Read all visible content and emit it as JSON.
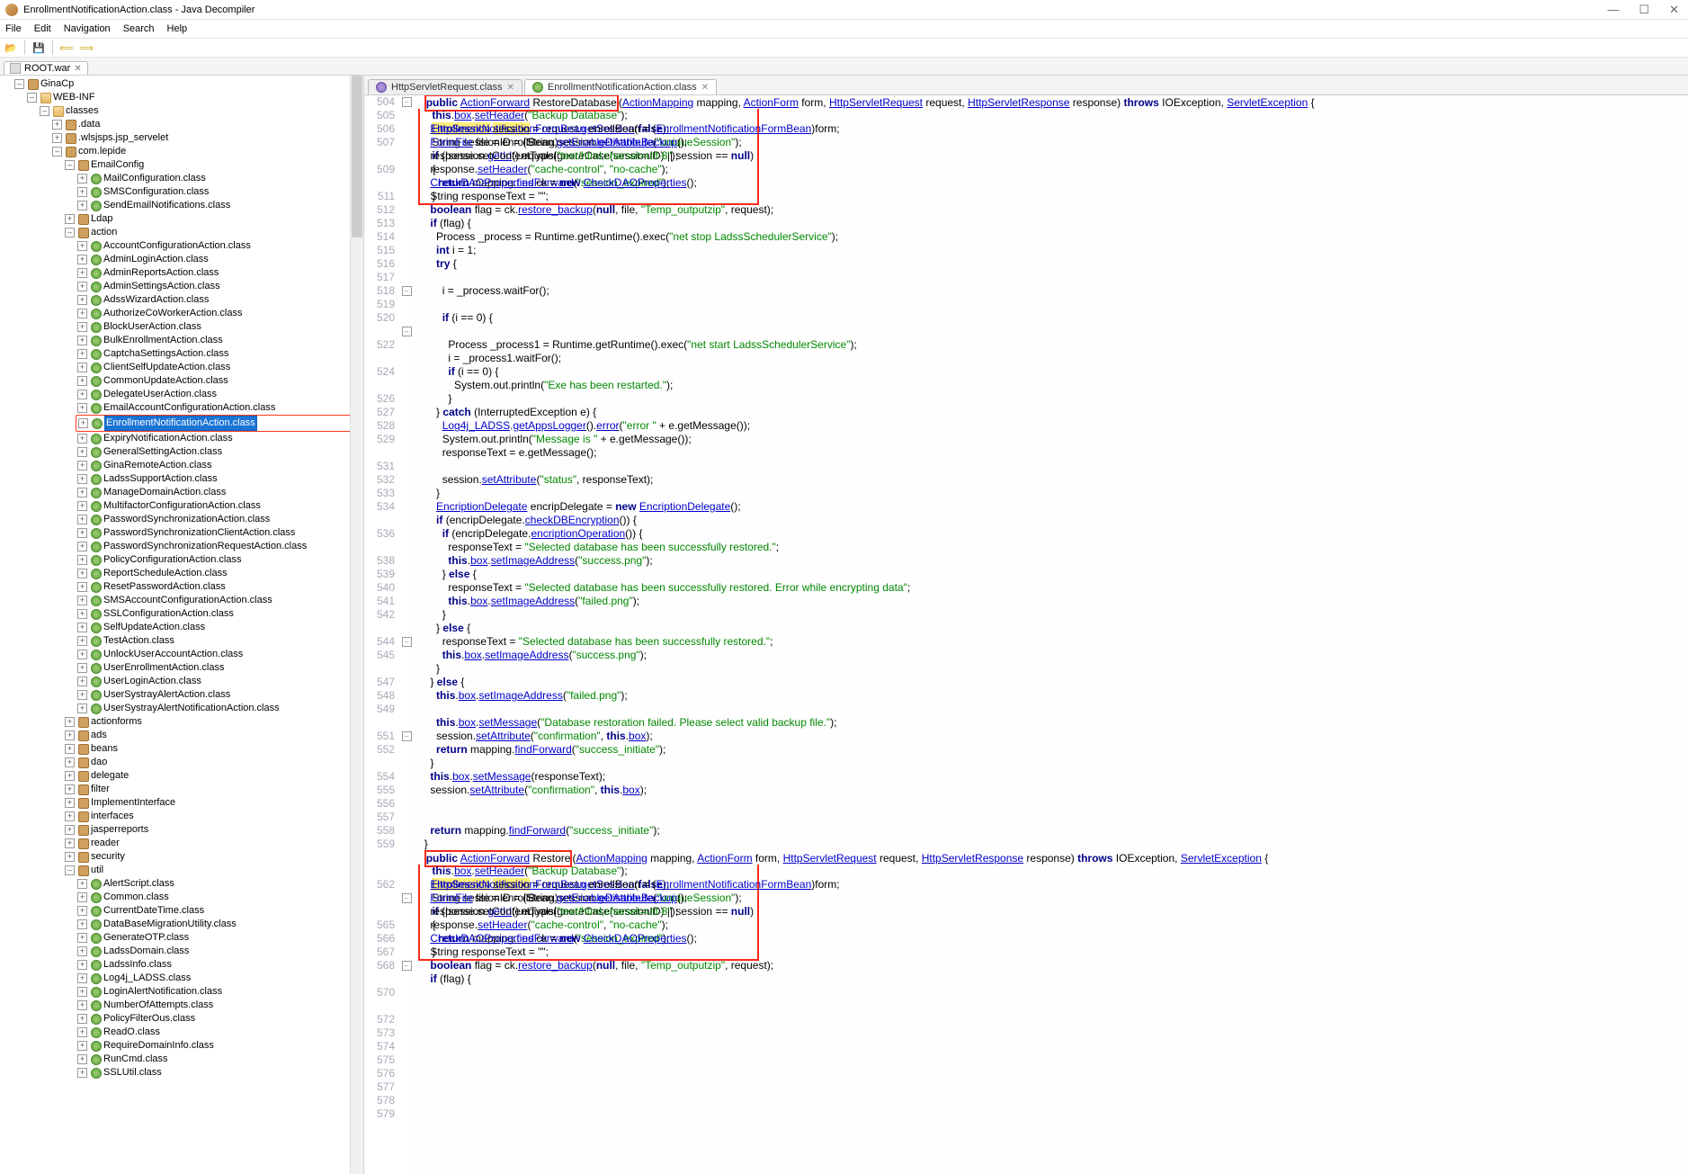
{
  "window_title": "EnrollmentNotificationAction.class - Java Decompiler",
  "menu": [
    "File",
    "Edit",
    "Navigation",
    "Search",
    "Help"
  ],
  "open_file_tab": "ROOT.war",
  "tree": {
    "root": "GinaCp",
    "webinf": "WEB-INF",
    "classes": "classes",
    "nodes1": [
      ".data",
      ".wlsjsps.jsp_servelet",
      "com.lepide"
    ],
    "emailConfig": "EmailConfig",
    "emailConfigItems": [
      "MailConfiguration.class",
      "SMSConfiguration.class",
      "SendEmailNotifications.class"
    ],
    "ldap": "Ldap",
    "action": "action",
    "actionItems": [
      "AccountConfigurationAction.class",
      "AdminLoginAction.class",
      "AdminReportsAction.class",
      "AdminSettingsAction.class",
      "AdssWizardAction.class",
      "AuthorizeCoWorkerAction.class",
      "BlockUserAction.class",
      "BulkEnrollmentAction.class",
      "CaptchaSettingsAction.class",
      "ClientSelfUpdateAction.class",
      "CommonUpdateAction.class",
      "DelegateUserAction.class",
      "EmailAccountConfigurationAction.class"
    ],
    "selected": "EnrollmentNotificationAction.class",
    "actionItems2": [
      "EnrollmentNotificationAction.class",
      "ExpiryNotificationAction.class",
      "GeneralSettingAction.class",
      "GinaRemoteAction.class",
      "LadssSupportAction.class",
      "ManageDomainAction.class",
      "MultifactorConfigurationAction.class",
      "PasswordSynchronizationAction.class",
      "PasswordSynchronizationClientAction.class",
      "PasswordSynchronizationRequestAction.class",
      "PolicyConfigurationAction.class",
      "ReportScheduleAction.class",
      "ResetPasswordAction.class",
      "SMSAccountConfigurationAction.class",
      "SSLConfigurationAction.class",
      "SelfUpdateAction.class",
      "TestAction.class",
      "UnlockUserAccountAction.class",
      "UserEnrollmentAction.class",
      "UserLoginAction.class",
      "UserSystrayAlertAction.class",
      "UserSystrayAlertNotificationAction.class"
    ],
    "folders2": [
      "actionforms",
      "ads",
      "beans",
      "dao",
      "delegate",
      "filter",
      "ImplementInterface",
      "interfaces",
      "jasperreports",
      "reader",
      "security"
    ],
    "util": "util",
    "utilItems": [
      "AlertScript.class",
      "Common.class",
      "CurrentDateTime.class",
      "DataBaseMigrationUtility.class",
      "GenerateOTP.class",
      "LadssDomain.class",
      "LadssInfo.class",
      "Log4j_LADSS.class",
      "LoginAlertNotification.class",
      "NumberOfAttempts.class",
      "PolicyFilterOus.class",
      "ReadO.class",
      "RequireDomainInfo.class",
      "RunCmd.class",
      "SSLUtil.class"
    ]
  },
  "editor_tabs": [
    {
      "label": "HttpServletRequest.class",
      "active": false
    },
    {
      "label": "EnrollmentNotificationAction.class",
      "active": true
    }
  ],
  "line_numbers": [
    "504",
    "505",
    "506",
    "507",
    "",
    "509",
    "",
    "511",
    "512",
    "513",
    "514",
    "515",
    "516",
    "517",
    "518",
    "519",
    "520",
    "",
    "522",
    "",
    "524",
    "",
    "526",
    "527",
    "528",
    "529",
    "",
    "531",
    "532",
    "533",
    "534",
    "",
    "536",
    "",
    "538",
    "539",
    "540",
    "541",
    "542",
    "",
    "544",
    "545",
    "",
    "547",
    "548",
    "549",
    "",
    "551",
    "552",
    "",
    "554",
    "555",
    "556",
    "557",
    "558",
    "559",
    "",
    "",
    "562",
    "",
    "",
    "565",
    "566",
    "567",
    "568",
    "",
    "570",
    "",
    "572",
    "573",
    "574",
    "575",
    "576",
    "577",
    "578",
    "579"
  ],
  "chart_data": null
}
